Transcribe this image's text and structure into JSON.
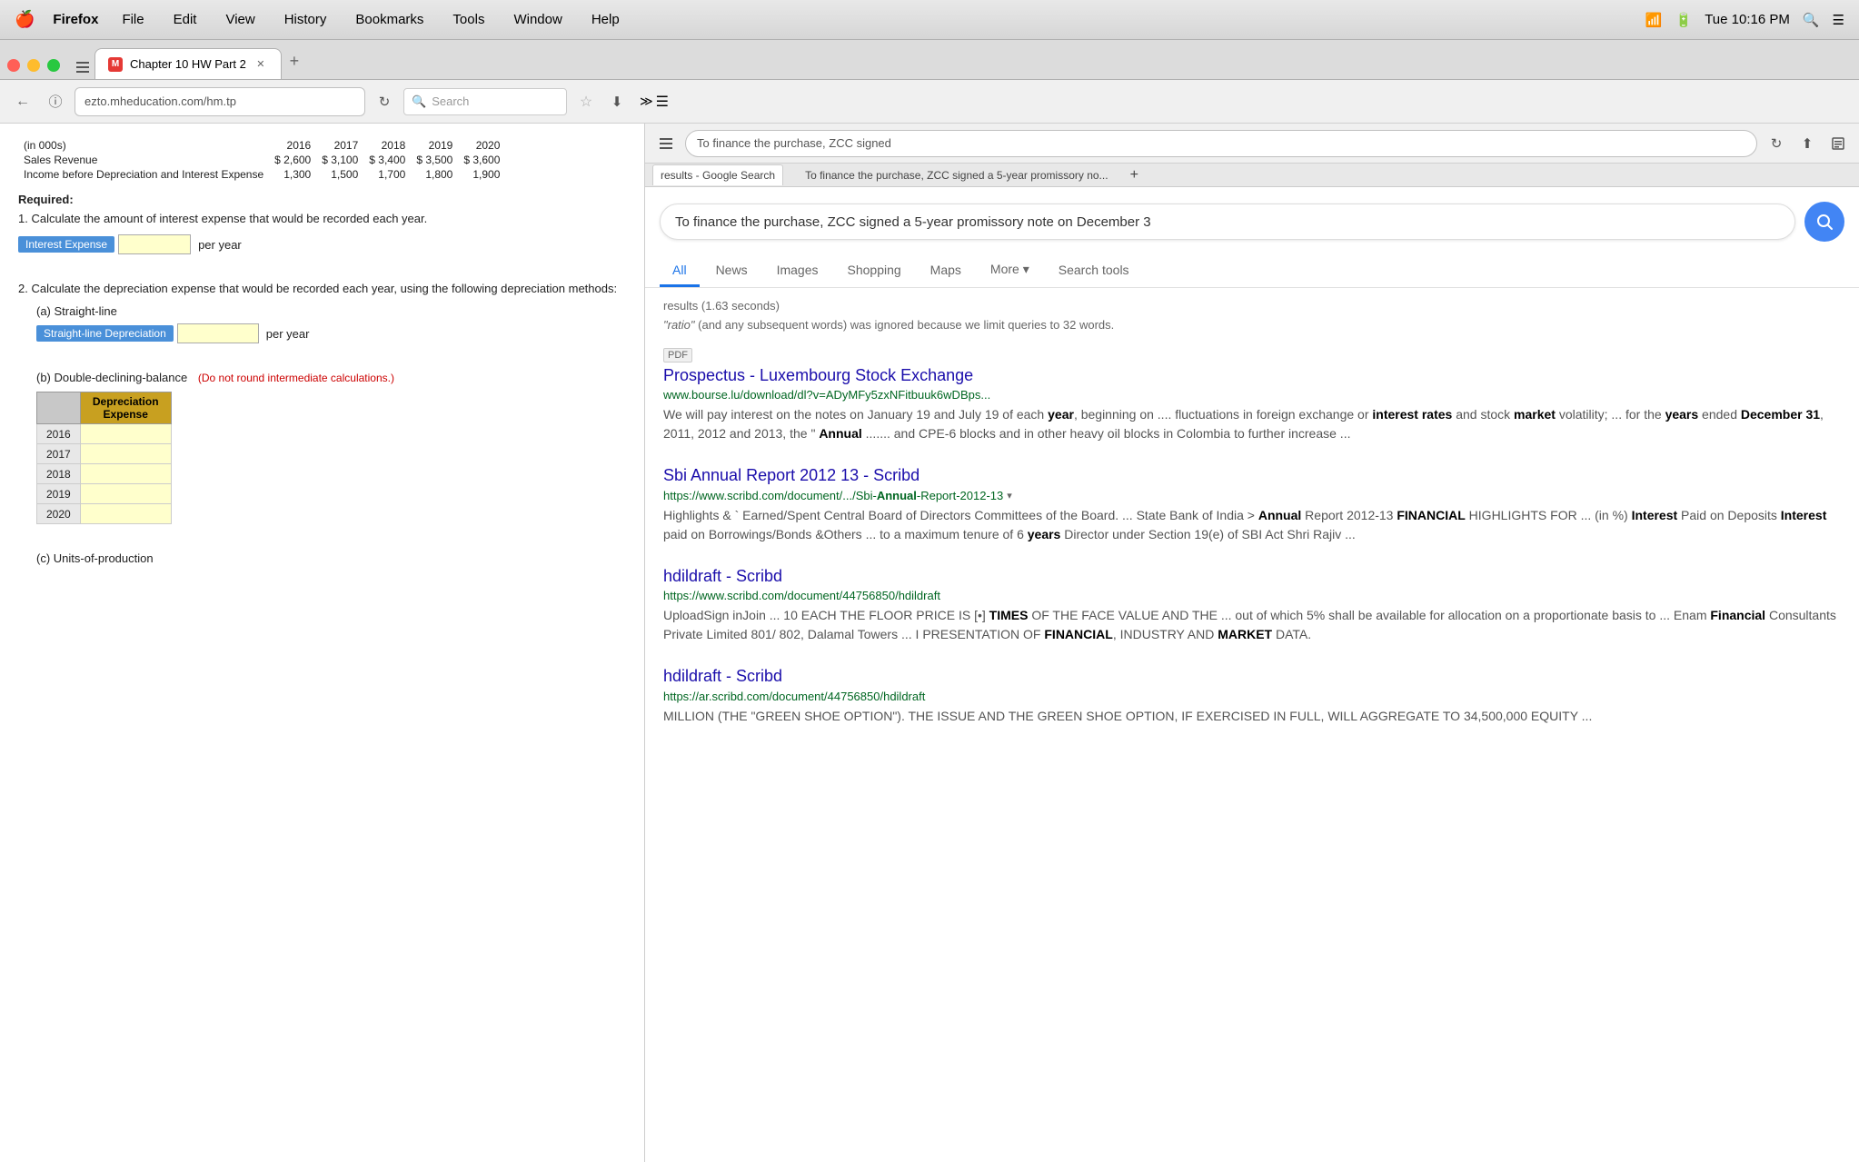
{
  "os": {
    "menu_bar": {
      "apple": "🍎",
      "app_name": "Firefox",
      "menus": [
        "File",
        "Edit",
        "View",
        "History",
        "Bookmarks",
        "Tools",
        "Window",
        "Help"
      ],
      "time": "Tue 10:16 PM"
    }
  },
  "browser": {
    "tabs": [
      {
        "id": "tab1",
        "label": "Chapter 10 HW Part 2",
        "favicon": "M",
        "active": true
      },
      {
        "id": "tab2",
        "label": "To finance the purchase, ZCC signed a 5-year promissory no...",
        "active": false
      }
    ],
    "new_tab_label": "+",
    "left_url": "ezto.mheducation.com/hm.tp",
    "left_search_placeholder": "Search",
    "right_url": "To finance the purchase, ZCC signed",
    "nav": {
      "back": "←",
      "info": "ⓘ",
      "refresh": "↻",
      "more": "≡"
    }
  },
  "homework": {
    "table": {
      "header": [
        "(in 000s)",
        "2016",
        "2017",
        "2018",
        "2019",
        "2020"
      ],
      "rows": [
        {
          "label": "Sales Revenue",
          "values": [
            "$ 2,600",
            "$ 3,100",
            "$ 3,400",
            "$ 3,500",
            "$ 3,600"
          ]
        },
        {
          "label": "Income before Depreciation and Interest Expense",
          "values": [
            "1,300",
            "1,500",
            "1,700",
            "1,800",
            "1,900"
          ]
        }
      ]
    },
    "required_label": "Required:",
    "question1": "1.  Calculate the amount of interest expense that would be recorded each year.",
    "interest_expense_label": "Interest Expense",
    "per_year_1": "per year",
    "question2": "2.  Calculate the depreciation expense that would be recorded each year, using the following depreciation methods:",
    "section_a_label": "(a) Straight-line",
    "straight_line_label": "Straight-line Depreciation",
    "per_year_2": "per year",
    "section_b_label": "(b) Double-declining-balance",
    "note_b": "(Do not round intermediate calculations.)",
    "dep_table": {
      "col_headers": [
        "",
        "Depreciation Expense"
      ],
      "rows": [
        {
          "year": "2016",
          "value": ""
        },
        {
          "year": "2017",
          "value": ""
        },
        {
          "year": "2018",
          "value": ""
        },
        {
          "year": "2019",
          "value": ""
        },
        {
          "year": "2020",
          "value": ""
        }
      ]
    },
    "section_c_label": "(c) Units-of-production"
  },
  "google": {
    "search_query": "To finance the purchase, ZCC signed a 5-year promissory note on December 3",
    "tabs": [
      {
        "label": "All",
        "active": true
      },
      {
        "label": "News",
        "active": false
      },
      {
        "label": "Images",
        "active": false
      },
      {
        "label": "Shopping",
        "active": false
      },
      {
        "label": "Maps",
        "active": false
      },
      {
        "label": "More",
        "active": false
      },
      {
        "label": "Search tools",
        "active": false
      }
    ],
    "results_count": "results (1.63 seconds)",
    "warning_text": "\"ratio\" (and any subsequent words) was ignored because we limit queries to 32 words.",
    "results": [
      {
        "id": "r1",
        "tag": "PDF",
        "title": "Prospectus - Luxembourg Stock Exchange",
        "url": "www.bourse.lu/download/dl?v=ADyMFy5zxNFitbuuk6wDBps...",
        "snippet": "We will pay interest on the notes on January 19 and July 19 of each year, beginning on .... fluctuations in foreign exchange or interest rates and stock market volatility; ... for the years ended December 31, 2011, 2012 and 2013, the \" Annual ....... and CPE-6 blocks and in other heavy oil blocks in Colombia to further increase ..."
      },
      {
        "id": "r2",
        "tag": "",
        "title": "Sbi Annual Report 2012 13 - Scribd",
        "url": "https://www.scribd.com/document/.../Sbi-Annual-Report-2012-13",
        "url_dropdown": true,
        "snippet": "Highlights & ` Earned/Spent Central Board of Directors Committees of the Board. ... State Bank of India > Annual Report 2012-13 FINANCIAL HIGHLIGHTS FOR ... (in %) Interest Paid on Deposits Interest paid on Borrowings/Bonds &Others ... to a maximum tenure of 6 years Director under Section 19(e) of SBI Act Shri Rajiv ..."
      },
      {
        "id": "r3",
        "tag": "",
        "title": "hdildraft - Scribd",
        "url": "https://www.scribd.com/document/44756850/hdildraft",
        "snippet": "UploadSign inJoin ... 10 EACH THE FLOOR PRICE IS [•] TIMES OF THE FACE VALUE AND THE ... out of which 5% shall be available for allocation on a proportionate basis to ... Enam Financial Consultants Private Limited 801/ 802, Dalamal Towers ... I PRESENTATION OF FINANCIAL, INDUSTRY AND MARKET DATA."
      },
      {
        "id": "r4",
        "tag": "",
        "title": "hdildraft - Scribd",
        "url": "https://ar.scribd.com/document/44756850/hdildraft",
        "snippet": "MILLION (THE \"GREEN SHOE OPTION\"). THE ISSUE AND THE GREEN SHOE OPTION, IF EXERCISED IN FULL, WILL AGGREGATE TO 34,500,000 EQUITY ..."
      }
    ]
  }
}
